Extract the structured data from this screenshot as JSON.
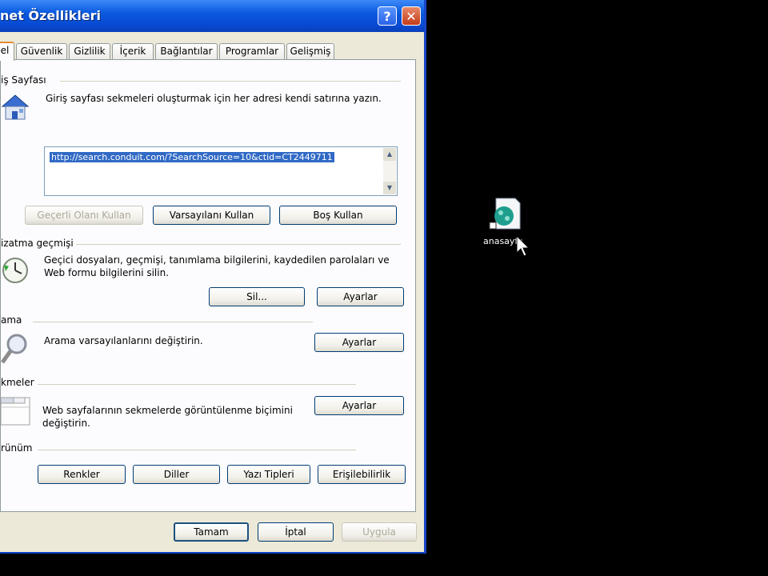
{
  "window": {
    "title": "net Özellikleri",
    "help_label": "?",
    "close_label": "✕"
  },
  "tabs": [
    {
      "label": "el",
      "active": true
    },
    {
      "label": "Güvenlik"
    },
    {
      "label": "Gizlilik"
    },
    {
      "label": "İçerik"
    },
    {
      "label": "Bağlantılar"
    },
    {
      "label": "Programlar"
    },
    {
      "label": "Gelişmiş"
    }
  ],
  "home": {
    "title": "iş Sayfası",
    "description": "Giriş sayfası sekmeleri oluşturmak için her adresi kendi satırına yazın.",
    "url": "http://search.conduit.com/?SearchSource=10&ctid=CT2449711",
    "buttons": {
      "current": "Geçerli Olanı Kullan",
      "default": "Varsayılanı Kullan",
      "blank": "Boş Kullan"
    }
  },
  "history": {
    "title": "izatma geçmişi",
    "description": "Geçici dosyaları, geçmişi, tanımlama bilgilerini, kaydedilen parolaları ve Web formu bilgilerini silin.",
    "delete_label": "Sil...",
    "settings_label": "Ayarlar"
  },
  "search": {
    "title": "ama",
    "description": "Arama varsayılanlarını değiştirin.",
    "settings_label": "Ayarlar"
  },
  "tabsgroup": {
    "title": "kmeler",
    "description_line1": "Web sayfalarının sekmelerde görüntülenme biçimini",
    "description_line2": "değiştirin.",
    "settings_label": "Ayarlar"
  },
  "appearance": {
    "title": "rünüm",
    "buttons": {
      "colors": "Renkler",
      "languages": "Diller",
      "fonts": "Yazı Tipleri",
      "accessibility": "Erişilebilirlik"
    }
  },
  "footer": {
    "ok": "Tamam",
    "cancel": "İptal",
    "apply": "Uygula"
  },
  "desktop_icon": {
    "label": "anasayfa"
  }
}
